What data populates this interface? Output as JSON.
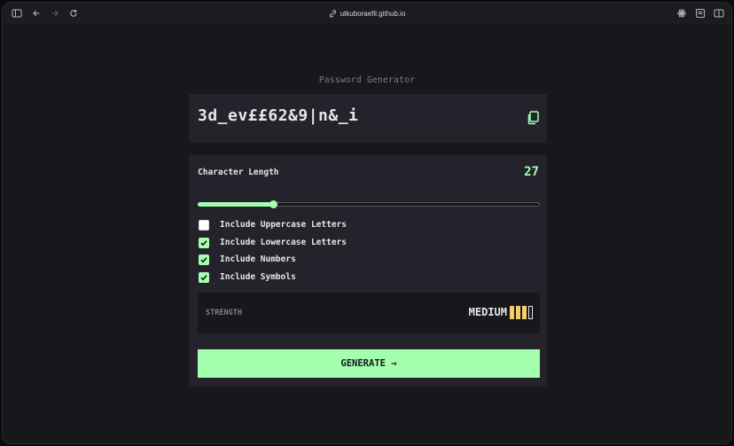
{
  "browser": {
    "url": "utkuboraefil.github.io"
  },
  "app": {
    "title": "Password Generator",
    "password": "3d_ev££62&9|n&_i",
    "length_label": "Character Length",
    "length_value": "27",
    "slider_fraction": 0.22,
    "options": [
      {
        "label": "Include Uppercase Letters",
        "checked": false
      },
      {
        "label": "Include Lowercase Letters",
        "checked": true
      },
      {
        "label": "Include Numbers",
        "checked": true
      },
      {
        "label": "Include Symbols",
        "checked": true
      }
    ],
    "strength_label": "STRENGTH",
    "strength_value": "MEDIUM",
    "strength_level": 3,
    "strength_max": 4,
    "generate_label": "GENERATE →"
  },
  "colors": {
    "accent": "#a4ffaf",
    "strength_medium": "#f8cd65",
    "panel": "#24232b",
    "background": "#18171c"
  }
}
